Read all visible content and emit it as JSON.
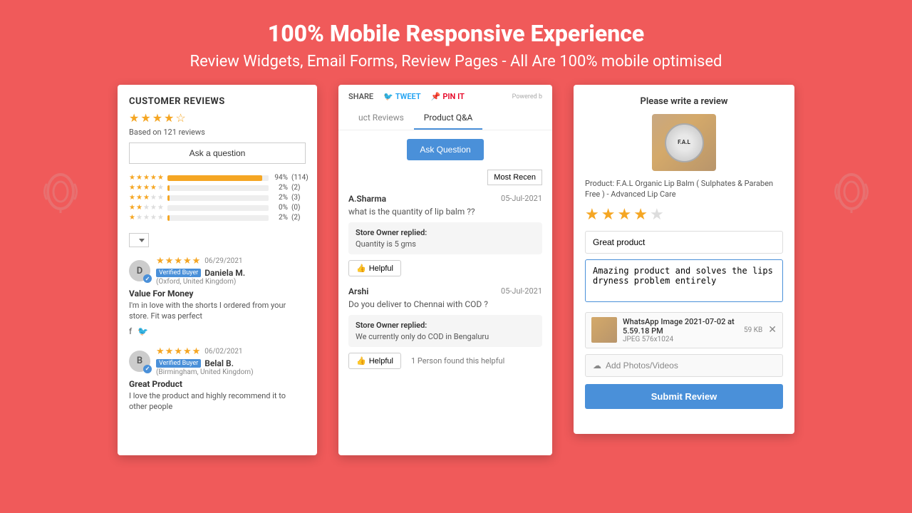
{
  "header": {
    "title": "100% Mobile Responsive Experience",
    "subtitle": "Review Widgets, Email Forms, Review Pages - All Are 100% mobile optimised"
  },
  "card1": {
    "section_title": "CUSTOMER REVIEWS",
    "overall_stars": 4,
    "based_on": "Based on 121 reviews",
    "ask_btn": "Ask a question",
    "ratings": [
      {
        "stars": 5,
        "pct": "94%",
        "count": "(114)",
        "fill": 94
      },
      {
        "stars": 4,
        "pct": "2%",
        "count": "(2)",
        "fill": 2
      },
      {
        "stars": 3,
        "pct": "2%",
        "count": "(3)",
        "fill": 2
      },
      {
        "stars": 2,
        "pct": "0%",
        "count": "(0)",
        "fill": 0
      },
      {
        "stars": 1,
        "pct": "2%",
        "count": "(2)",
        "fill": 2
      }
    ],
    "reviews": [
      {
        "avatar_letter": "D",
        "date": "06/29/2021",
        "verified": "Verified Buyer",
        "name": "Daniela M.",
        "location": "(Oxford, United Kingdom)",
        "title": "Value For Money",
        "text": "I'm in love with the shorts I ordered from your store. Fit was perfect",
        "stars": 5
      },
      {
        "avatar_letter": "B",
        "date": "06/02/2021",
        "verified": "Verified Buyer",
        "name": "Belal B.",
        "location": "(Birmingham, United Kingdom)",
        "title": "Great Product",
        "text": "I love the product and highly recommend it to other people",
        "stars": 5
      }
    ]
  },
  "card2": {
    "share": "SHARE",
    "tweet": "TWEET",
    "pin": "PIN IT",
    "powered_by": "Powered b",
    "tabs": [
      "uct Reviews",
      "Product Q&A"
    ],
    "active_tab": "Product Q&A",
    "ask_question_btn": "Ask Question",
    "most_recent_btn": "Most Recen",
    "qa_items": [
      {
        "author": "A.Sharma",
        "date": "05-Jul-2021",
        "question": "what is the quantity of lip balm ??",
        "reply_label": "Store Owner replied:",
        "reply": "Quantity is 5 gms",
        "helpful_btn": "Helpful",
        "helpful_count": ""
      },
      {
        "author": "Arshi",
        "date": "05-Jul-2021",
        "question": "Do you deliver to Chennai with COD ?",
        "reply_label": "Store Owner replied:",
        "reply": "We currently only do COD in Bengaluru",
        "helpful_btn": "Helpful",
        "helpful_count": "1 Person found this helpful"
      }
    ]
  },
  "card3": {
    "title": "Please write a review",
    "product_name": "Product: F.A.L Organic Lip Balm ( Sulphates & Paraben Free ) - Advanced Lip Care",
    "fal_label": "F.A.L",
    "stars_filled": 4,
    "stars_empty": 1,
    "title_placeholder": "Great product",
    "body_text": "Amazing product and solves the lips dryness problem entirely",
    "file_name": "WhatsApp Image 2021-07-02 at 5.59.18 PM",
    "file_type": "JPEG  576x1024",
    "file_size": "59 KB",
    "add_photos_btn": "Add Photos/Videos",
    "submit_btn": "Submit Review"
  }
}
